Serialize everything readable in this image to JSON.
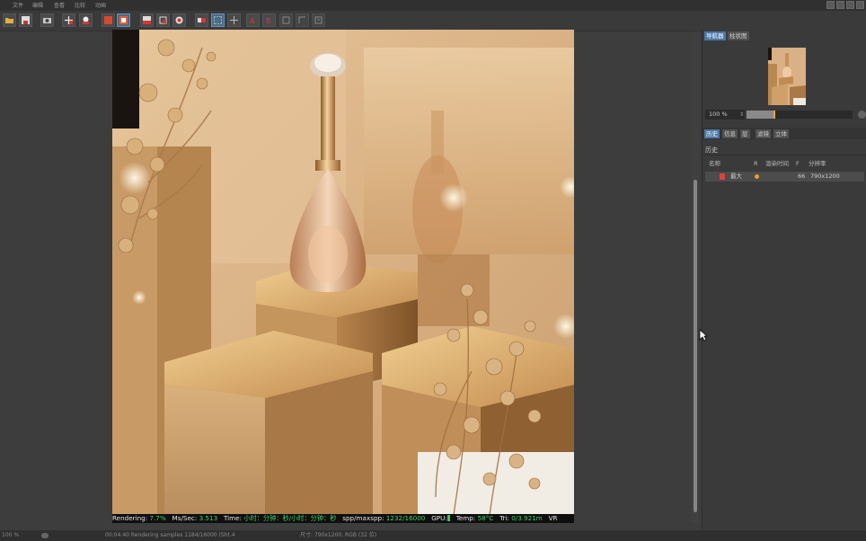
{
  "menu": {
    "items": [
      "文件",
      "编辑",
      "查看",
      "比较",
      "动画"
    ]
  },
  "toolbar": {
    "buttons": [
      "open-icon",
      "save-icon",
      "snapshot-icon",
      "region-icon",
      "render-icon",
      "red-render-icon",
      "render-active-icon",
      "stop-icon",
      "region-render-icon",
      "ab-icon",
      "compare-icon",
      "split-icon",
      "channel-a-icon",
      "channel-b-icon",
      "filter-icon",
      "lut-icon",
      "export-icon"
    ]
  },
  "render_status": {
    "rendering_label": "Rendering:",
    "rendering_value": "7.7%",
    "ms_label": "Ms/Sec:",
    "ms_value": "3.513",
    "time_label": "Time:",
    "time_value": "小时：分钟：秒/小时：分钟：秒",
    "spp_label": "spp/maxspp:",
    "spp_value": "1232/16000",
    "gpu_label": "GPU:",
    "temp_label": "Temp:",
    "temp_value": "58°C",
    "tri_label": "Tri:",
    "tri_value": "0/3.921m",
    "vr_label": "VR"
  },
  "panel": {
    "top_tabs": [
      "导航器",
      "柱状图"
    ],
    "zoom_value": "100 %",
    "zoom_level_percent": 25,
    "tabs": [
      "历史",
      "信息",
      "层",
      "滤镜",
      "立体"
    ],
    "history_label": "历史",
    "columns": [
      "名称",
      "R",
      "渲染时间",
      "F",
      "分辨率"
    ],
    "history_row": {
      "name": "最大",
      "render_time": "",
      "frame": "66",
      "resolution": "790x1200"
    }
  },
  "bottom": {
    "zoom": "100 %",
    "message": "00:04:40 Rendering samples 1184/16000 (Sht.4",
    "size_info": "尺寸: 790x1200, RGB (32 位)"
  },
  "colors": {
    "accent": "#4a78a8",
    "status_green": "#45d06b",
    "render_gold": "#c9995c"
  }
}
